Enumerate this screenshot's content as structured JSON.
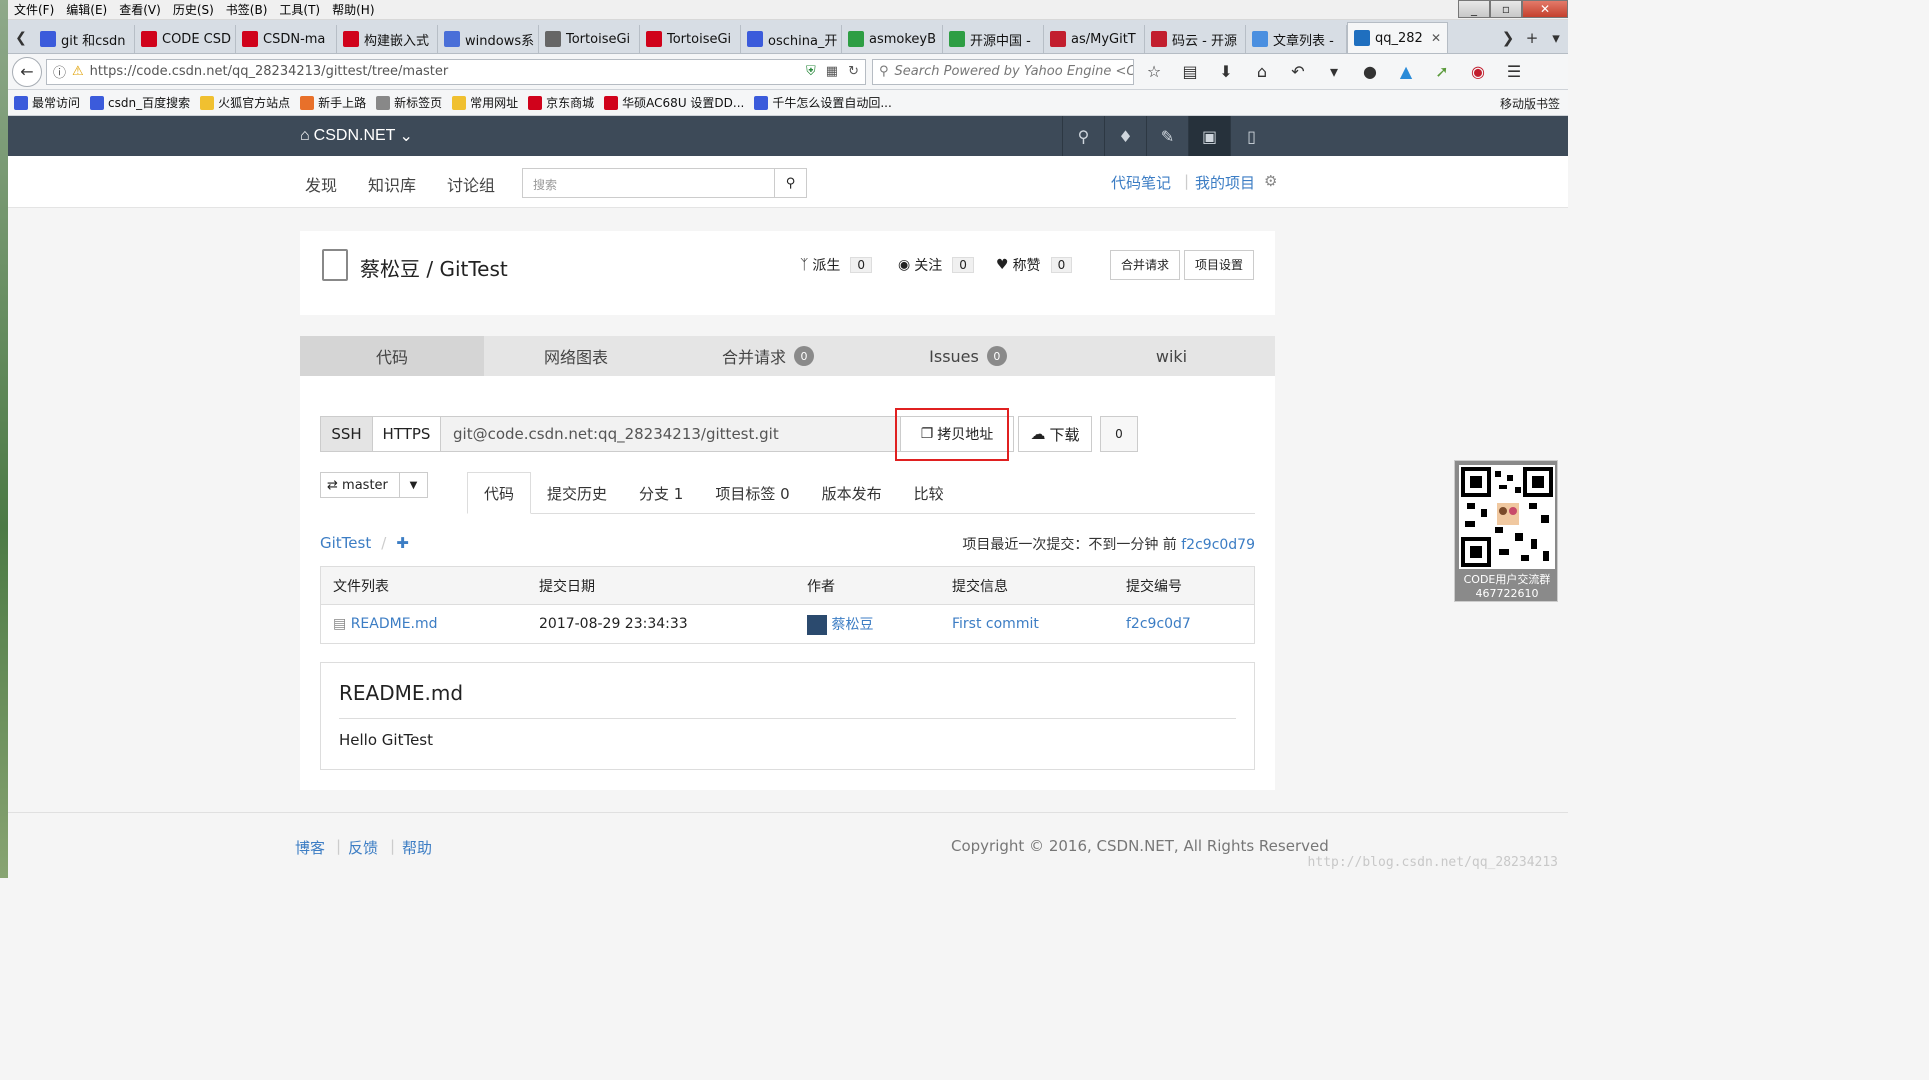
{
  "menu": [
    "文件(F)",
    "编辑(E)",
    "查看(V)",
    "历史(S)",
    "书签(B)",
    "工具(T)",
    "帮助(H)"
  ],
  "tabs": [
    {
      "label": "git 和csdn",
      "color": "#3b5bdb"
    },
    {
      "label": "CODE CSD",
      "color": "#d0021b"
    },
    {
      "label": "CSDN-ma",
      "color": "#d0021b"
    },
    {
      "label": "构建嵌入式",
      "color": "#d0021b"
    },
    {
      "label": "windows系",
      "color": "#4a6fd8"
    },
    {
      "label": "TortoiseGi",
      "color": "#666"
    },
    {
      "label": "TortoiseGi",
      "color": "#d0021b"
    },
    {
      "label": "oschina_开",
      "color": "#3b5bdb"
    },
    {
      "label": "asmokeyB",
      "color": "#2e9e44"
    },
    {
      "label": "开源中国 -",
      "color": "#2e9e44"
    },
    {
      "label": "as/MyGitT",
      "color": "#c21e2e"
    },
    {
      "label": "码云 - 开源",
      "color": "#c21e2e"
    },
    {
      "label": "文章列表 -",
      "color": "#4a8fe0"
    },
    {
      "label": "qq_282",
      "color": "#1f6fbf",
      "active": true
    }
  ],
  "url": "https://code.csdn.net/qq_28234213/gittest/tree/master",
  "search_placeholder": "Search Powered by Yahoo Engine <Ctrl",
  "bookmarks": [
    {
      "label": "最常访问",
      "color": "#3b5bdb"
    },
    {
      "label": "csdn_百度搜索",
      "color": "#3b5bdb"
    },
    {
      "label": "火狐官方站点",
      "color": "#f0c030"
    },
    {
      "label": "新手上路",
      "color": "#e8702a"
    },
    {
      "label": "新标签页",
      "color": "#888"
    },
    {
      "label": "常用网址",
      "color": "#f0c030"
    },
    {
      "label": "京东商城",
      "color": "#d0021b"
    },
    {
      "label": "华硕AC68U 设置DD...",
      "color": "#d0021b"
    },
    {
      "label": "千牛怎么设置自动回...",
      "color": "#3b5bdb"
    }
  ],
  "mobile_bookmarks": "移动版书签",
  "site": {
    "logo": "CSDN.NET"
  },
  "subnav": {
    "links": [
      "发现",
      "知识库",
      "讨论组"
    ],
    "search_placeholder": "搜索",
    "right": [
      "代码笔记",
      "我的项目"
    ]
  },
  "repo": {
    "title": "蔡松豆 / GitTest",
    "stats": [
      {
        "label": "派生",
        "count": "0"
      },
      {
        "label": "关注",
        "count": "0"
      },
      {
        "label": "称赞",
        "count": "0"
      }
    ],
    "buttons": [
      "合并请求",
      "项目设置"
    ]
  },
  "main_tabs": [
    {
      "label": "代码",
      "badge": ""
    },
    {
      "label": "网络图表",
      "badge": ""
    },
    {
      "label": "合并请求",
      "badge": "0"
    },
    {
      "label": "Issues",
      "badge": "0"
    },
    {
      "label": "wiki",
      "badge": ""
    }
  ],
  "clone": {
    "protocols": [
      "SSH",
      "HTTPS"
    ],
    "url": "git@code.csdn.net:qq_28234213/gittest.git",
    "copy_label": "拷贝地址",
    "download_label": "下载",
    "download_count": "0"
  },
  "branch": "master",
  "sub_tabs": [
    "代码",
    "提交历史",
    "分支 1",
    "项目标签 0",
    "版本发布",
    "比较"
  ],
  "crumb": "GitTest",
  "latest_commit": {
    "text": "项目最近一次提交：不到一分钟 前",
    "hash": "f2c9c0d79"
  },
  "file_table": {
    "headers": [
      "文件列表",
      "提交日期",
      "作者",
      "提交信息",
      "提交编号"
    ],
    "rows": [
      {
        "file": "README.md",
        "date": "2017-08-29 23:34:33",
        "author": "蔡松豆",
        "message": "First commit",
        "hash": "f2c9c0d7"
      }
    ]
  },
  "readme": {
    "title": "README.md",
    "body": "Hello GitTest"
  },
  "qr_text": "CODE用户交流群 467722610",
  "footer": {
    "links": [
      "博客",
      "反馈",
      "帮助"
    ],
    "copyright": "Copyright © 2016, CSDN.NET, All Rights Reserved"
  },
  "watermark": "http://blog.csdn.net/qq_28234213"
}
